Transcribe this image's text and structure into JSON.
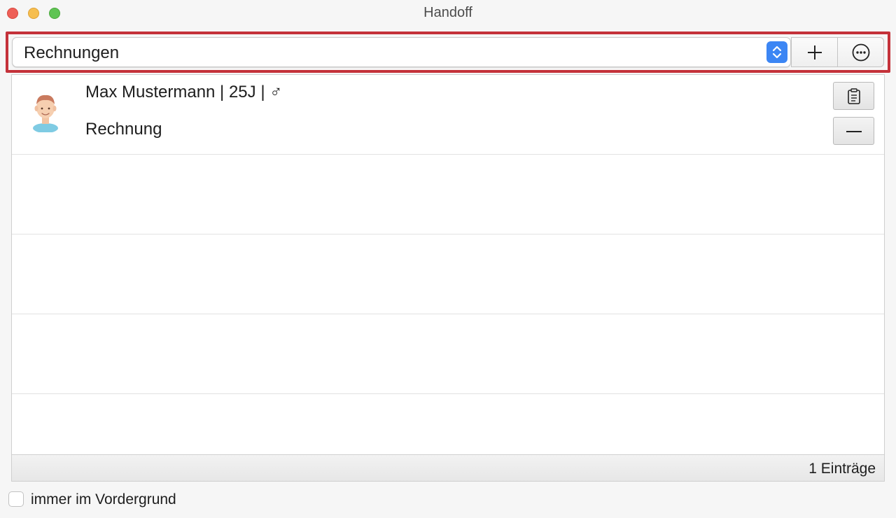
{
  "window": {
    "title": "Handoff"
  },
  "toolbar": {
    "selected_list": "Rechnungen",
    "add_icon": "plus-icon",
    "more_icon": "ellipsis-circle-icon"
  },
  "entries": [
    {
      "name_line": "Max Mustermann | 25J | ♂",
      "type_line": "Rechnung",
      "avatar_icon": "male-avatar-icon",
      "actions": [
        "clipboard-icon",
        "minus-icon"
      ]
    }
  ],
  "footer": {
    "count_text": "1 Einträge"
  },
  "options": {
    "always_on_top_label": "immer im Vordergrund",
    "always_on_top_checked": false
  },
  "colors": {
    "accent": "#3c86f4",
    "highlight_border": "#c4323a"
  }
}
